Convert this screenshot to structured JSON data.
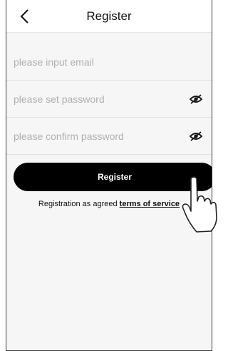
{
  "header": {
    "title": "Register",
    "back_icon": "chevron-left-icon"
  },
  "form": {
    "email_placeholder": "please input email",
    "password_placeholder": "please set password",
    "confirm_placeholder": "please confirm password",
    "visibility_icon": "eye-slash-icon"
  },
  "actions": {
    "register_label": "Register",
    "agree_prefix": "Registration as agreed",
    "terms_link": "terms of service"
  },
  "overlay": {
    "pointer_icon": "hand-pointer-icon"
  },
  "colors": {
    "button_bg": "#000000",
    "page_bg": "#f6f6f6",
    "placeholder": "#b0b0b0"
  }
}
